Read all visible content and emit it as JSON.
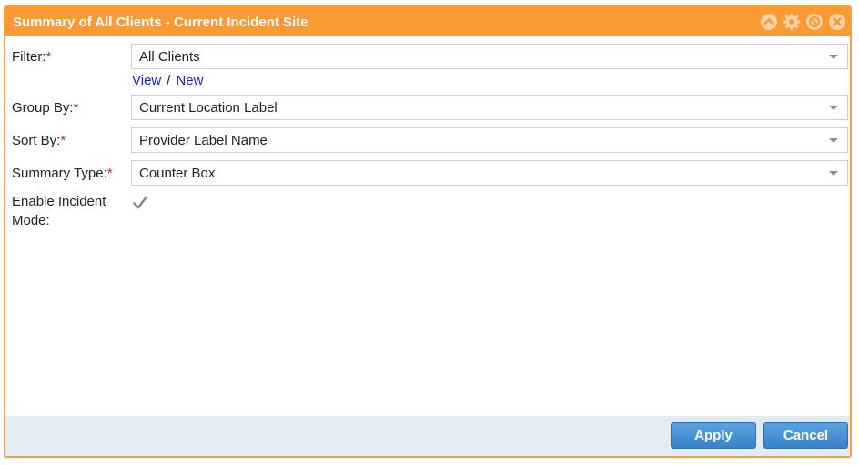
{
  "window": {
    "title": "Summary of All Clients - Current Incident Site",
    "icons": [
      "collapse-icon",
      "gear-icon",
      "block-icon",
      "close-icon"
    ]
  },
  "form": {
    "filter": {
      "label": "Filter:",
      "required": "*",
      "value": "All Clients"
    },
    "filter_links": {
      "view": "View",
      "separator": "/",
      "new": "New"
    },
    "group_by": {
      "label": "Group By:",
      "required": "*",
      "value": "Current Location Label"
    },
    "sort_by": {
      "label": "Sort By:",
      "required": "*",
      "value": "Provider Label Name"
    },
    "summary_type": {
      "label": "Summary Type:",
      "required": "*",
      "value": "Counter Box"
    },
    "incident_mode": {
      "label_line1": "Enable Incident",
      "label_line2": "Mode:",
      "checked": true
    }
  },
  "footer": {
    "apply_label": "Apply",
    "cancel_label": "Cancel"
  },
  "colors": {
    "titlebar": "#f99a33",
    "border": "#f7a13b",
    "footer_bg": "#e4ebf2",
    "button": "#3a82c8",
    "required": "#e02020",
    "link": "#1a1ad6"
  }
}
